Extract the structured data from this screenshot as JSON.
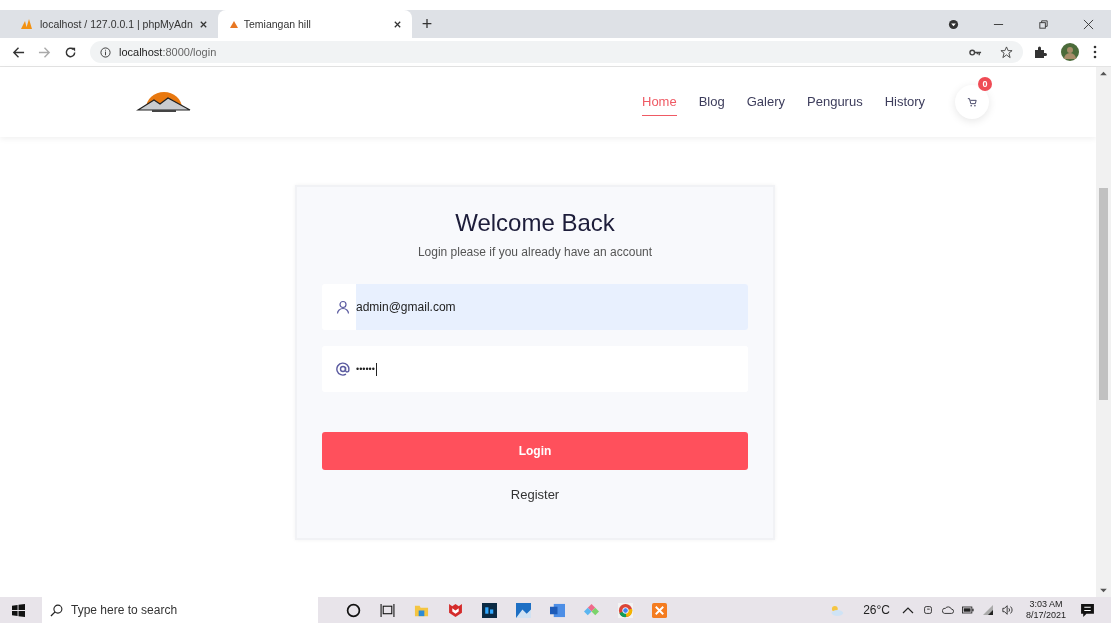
{
  "browser": {
    "tabs": [
      {
        "title": "localhost / 127.0.0.1 | phpMyAdn",
        "selected": false
      },
      {
        "title": "Temiangan hill",
        "selected": true
      }
    ],
    "new_tab": "+",
    "url_host": "localhost",
    "url_rest": ":8000/login"
  },
  "nav": {
    "items": [
      {
        "label": "Home",
        "selected": true
      },
      {
        "label": "Blog",
        "selected": false
      },
      {
        "label": "Galery",
        "selected": false
      },
      {
        "label": "Pengurus",
        "selected": false
      },
      {
        "label": "History",
        "selected": false
      }
    ],
    "cart_count": "0"
  },
  "login": {
    "title": "Welcome Back",
    "subtitle": "Login please if you already have an account",
    "email": "admin@gmail.com",
    "password": "••••••",
    "button": "Login",
    "register": "Register"
  },
  "taskbar": {
    "search_placeholder": "Type here to search",
    "weather": "26°C",
    "time": "3:03 AM",
    "date": "8/17/2021"
  }
}
